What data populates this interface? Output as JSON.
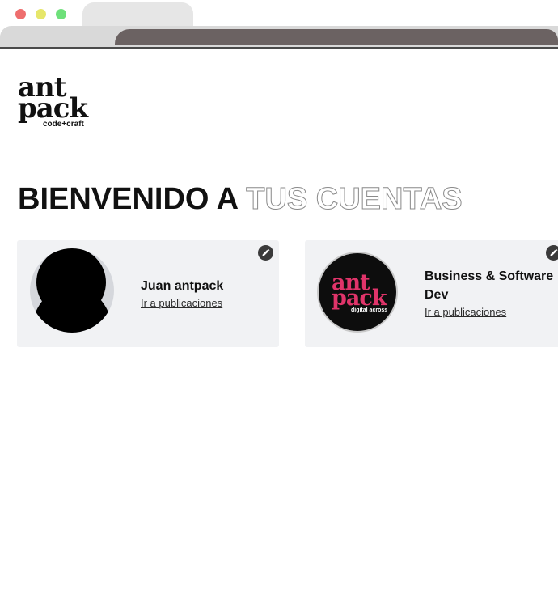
{
  "logo": {
    "line1": "ant",
    "line2": "pack",
    "tagline": "code+craft"
  },
  "heading": {
    "solid": "BIENVENIDO A",
    "outline": "TUS CUENTAS"
  },
  "accounts": [
    {
      "name": "Juan antpack",
      "link": "Ir a publicaciones",
      "avatar": "default-user-icon"
    },
    {
      "name": "Business & Software Dev",
      "link": "Ir a publicaciones",
      "avatar": {
        "line1": "ant",
        "line2": "pack",
        "tagline": "digital across"
      }
    }
  ],
  "icons": {
    "edit": "pencil-icon"
  },
  "colors": {
    "brand_pink": "#e0346a",
    "card_bg": "#f1f2f4"
  }
}
